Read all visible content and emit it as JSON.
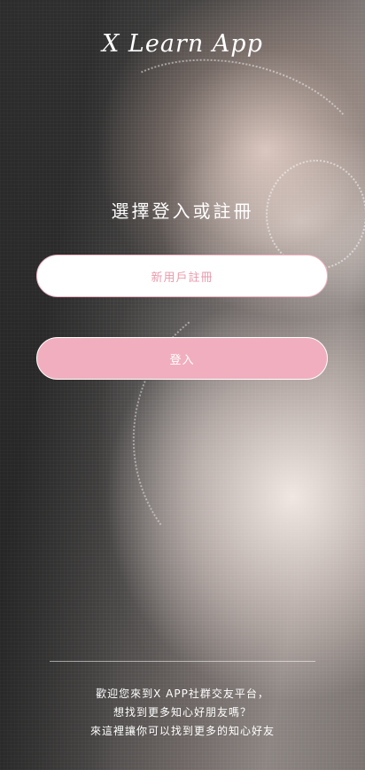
{
  "app": {
    "title": "X Learn App"
  },
  "main": {
    "heading": "選擇登入或註冊",
    "register_button_label": "新用戶註冊",
    "login_button_label": "登入"
  },
  "footer": {
    "lines": [
      "歡迎您來到X APP社群交友平台，",
      "想找到更多知心好朋友嗎？",
      "來這裡讓你可以找到更多的知心好友"
    ]
  },
  "colors": {
    "accent_pink": "#f1aebe",
    "register_text": "#e89aab",
    "text_light": "#ffffff"
  },
  "background": {
    "image": "background-photo"
  }
}
